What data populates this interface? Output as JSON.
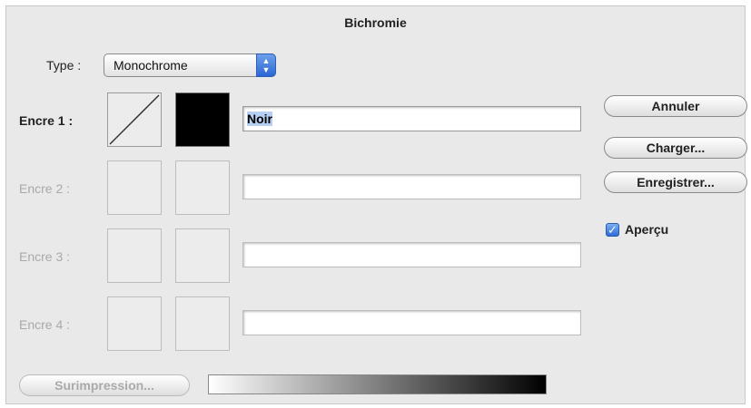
{
  "dialog": {
    "title": "Bichromie",
    "type_label": "Type :",
    "type_value": "Monochrome",
    "type_arrows_icon": "updown-arrows-icon"
  },
  "inks": [
    {
      "label": "Encre 1 :",
      "value": "Noir",
      "enabled": true
    },
    {
      "label": "Encre 2 :",
      "value": "",
      "enabled": false
    },
    {
      "label": "Encre 3 :",
      "value": "",
      "enabled": false
    },
    {
      "label": "Encre 4 :",
      "value": "",
      "enabled": false
    }
  ],
  "buttons": {
    "cancel": "Annuler",
    "load": "Charger...",
    "save": "Enregistrer...",
    "overprint": "Surimpression..."
  },
  "preview": {
    "label": "Aperçu",
    "checked": true,
    "check_icon": "checkmark-icon"
  },
  "colors": {
    "accent": "#2b66d4",
    "ink1_swatch": "#000000"
  }
}
